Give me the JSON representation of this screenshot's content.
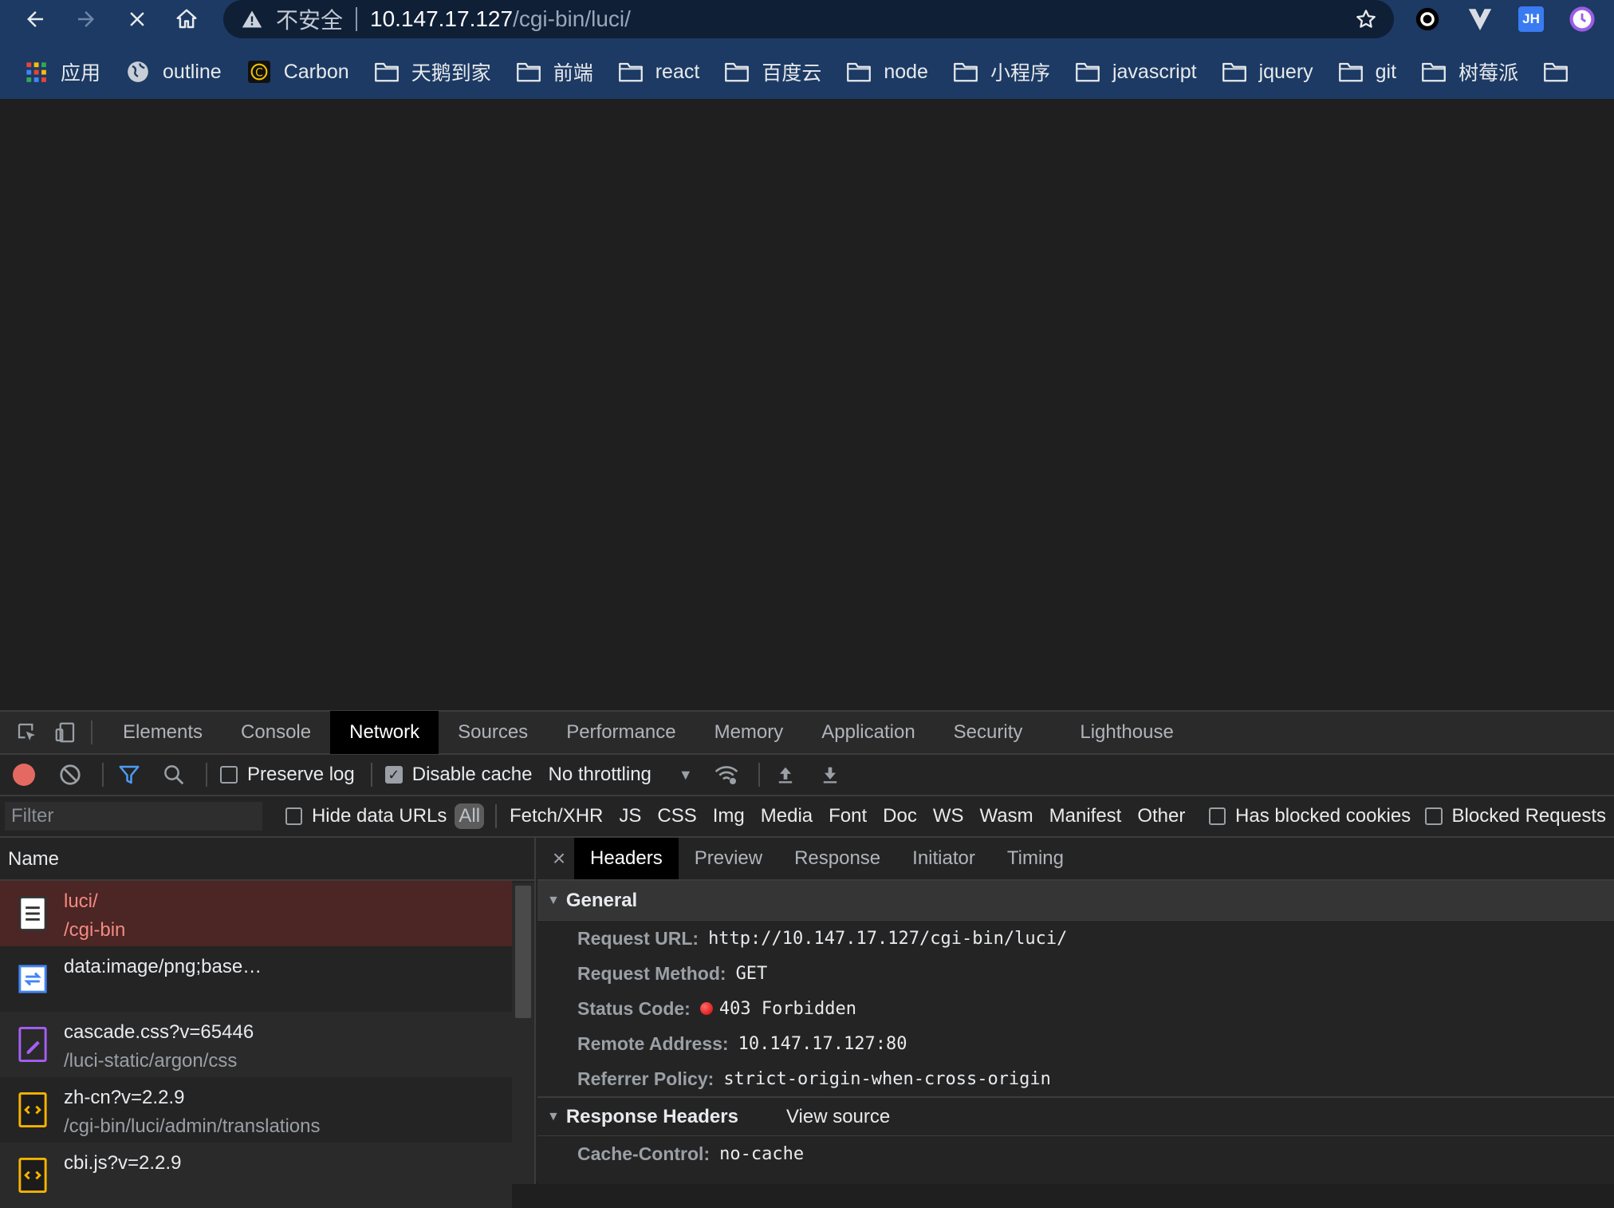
{
  "browser": {
    "url_warning": "不安全",
    "url_host": "10.147.17.127",
    "url_path": "/cgi-bin/luci/",
    "extensions": [
      "ext-circle-icon",
      "ext-v-icon",
      "ext-jh-icon",
      "ext-clock-icon"
    ],
    "ext_jh_label": "JH"
  },
  "bookmarks": [
    {
      "label": "应用",
      "icon": "apps-grid-icon"
    },
    {
      "label": "outline",
      "icon": "globe-icon"
    },
    {
      "label": "Carbon",
      "icon": "carbon-icon"
    },
    {
      "label": "天鹅到家",
      "icon": "folder-icon"
    },
    {
      "label": "前端",
      "icon": "folder-icon"
    },
    {
      "label": "react",
      "icon": "folder-icon"
    },
    {
      "label": "百度云",
      "icon": "folder-icon"
    },
    {
      "label": "node",
      "icon": "folder-icon"
    },
    {
      "label": "小程序",
      "icon": "folder-icon"
    },
    {
      "label": "javascript",
      "icon": "folder-icon"
    },
    {
      "label": "jquery",
      "icon": "folder-icon"
    },
    {
      "label": "git",
      "icon": "folder-icon"
    },
    {
      "label": "树莓派",
      "icon": "folder-icon"
    }
  ],
  "devtools": {
    "tabs": [
      "Elements",
      "Console",
      "Network",
      "Sources",
      "Performance",
      "Memory",
      "Application",
      "Security",
      "Lighthouse"
    ],
    "active_tab": "Network",
    "toolbar": {
      "preserve_log": "Preserve log",
      "disable_cache": "Disable cache",
      "throttling": "No throttling"
    },
    "filter": {
      "placeholder": "Filter",
      "hide_data_urls": "Hide data URLs",
      "all": "All",
      "types": [
        "Fetch/XHR",
        "JS",
        "CSS",
        "Img",
        "Media",
        "Font",
        "Doc",
        "WS",
        "Wasm",
        "Manifest",
        "Other"
      ],
      "has_blocked_cookies": "Has blocked cookies",
      "blocked_requests": "Blocked Requests"
    },
    "name_header": "Name",
    "requests": [
      {
        "name": "luci/",
        "path": "/cgi-bin",
        "icon": "document-icon",
        "selected": true
      },
      {
        "name": "data:image/png;base…",
        "path": "",
        "icon": "image-icon"
      },
      {
        "name": "cascade.css?v=65446",
        "path": "/luci-static/argon/css",
        "icon": "stylesheet-icon"
      },
      {
        "name": "zh-cn?v=2.2.9",
        "path": "/cgi-bin/luci/admin/translations",
        "icon": "script-icon"
      },
      {
        "name": "cbi.js?v=2.2.9",
        "path": "",
        "icon": "script-icon"
      }
    ],
    "detail_tabs": [
      "Headers",
      "Preview",
      "Response",
      "Initiator",
      "Timing"
    ],
    "detail_active": "Headers",
    "general": {
      "title": "General",
      "rows": [
        {
          "k": "Request URL:",
          "v": "http://10.147.17.127/cgi-bin/luci/"
        },
        {
          "k": "Request Method:",
          "v": "GET"
        },
        {
          "k": "Status Code:",
          "v": "403 Forbidden"
        },
        {
          "k": "Remote Address:",
          "v": "10.147.17.127:80"
        },
        {
          "k": "Referrer Policy:",
          "v": "strict-origin-when-cross-origin"
        }
      ]
    },
    "response_headers": {
      "title": "Response Headers",
      "view_source": "View source",
      "rows": [
        {
          "k": "Cache-Control:",
          "v": "no-cache"
        }
      ]
    },
    "colors": {
      "accent": "#4d9cf4",
      "error": "#f28b82",
      "selected_row": "#4c2525",
      "status_dot": "#e01b1b"
    }
  }
}
